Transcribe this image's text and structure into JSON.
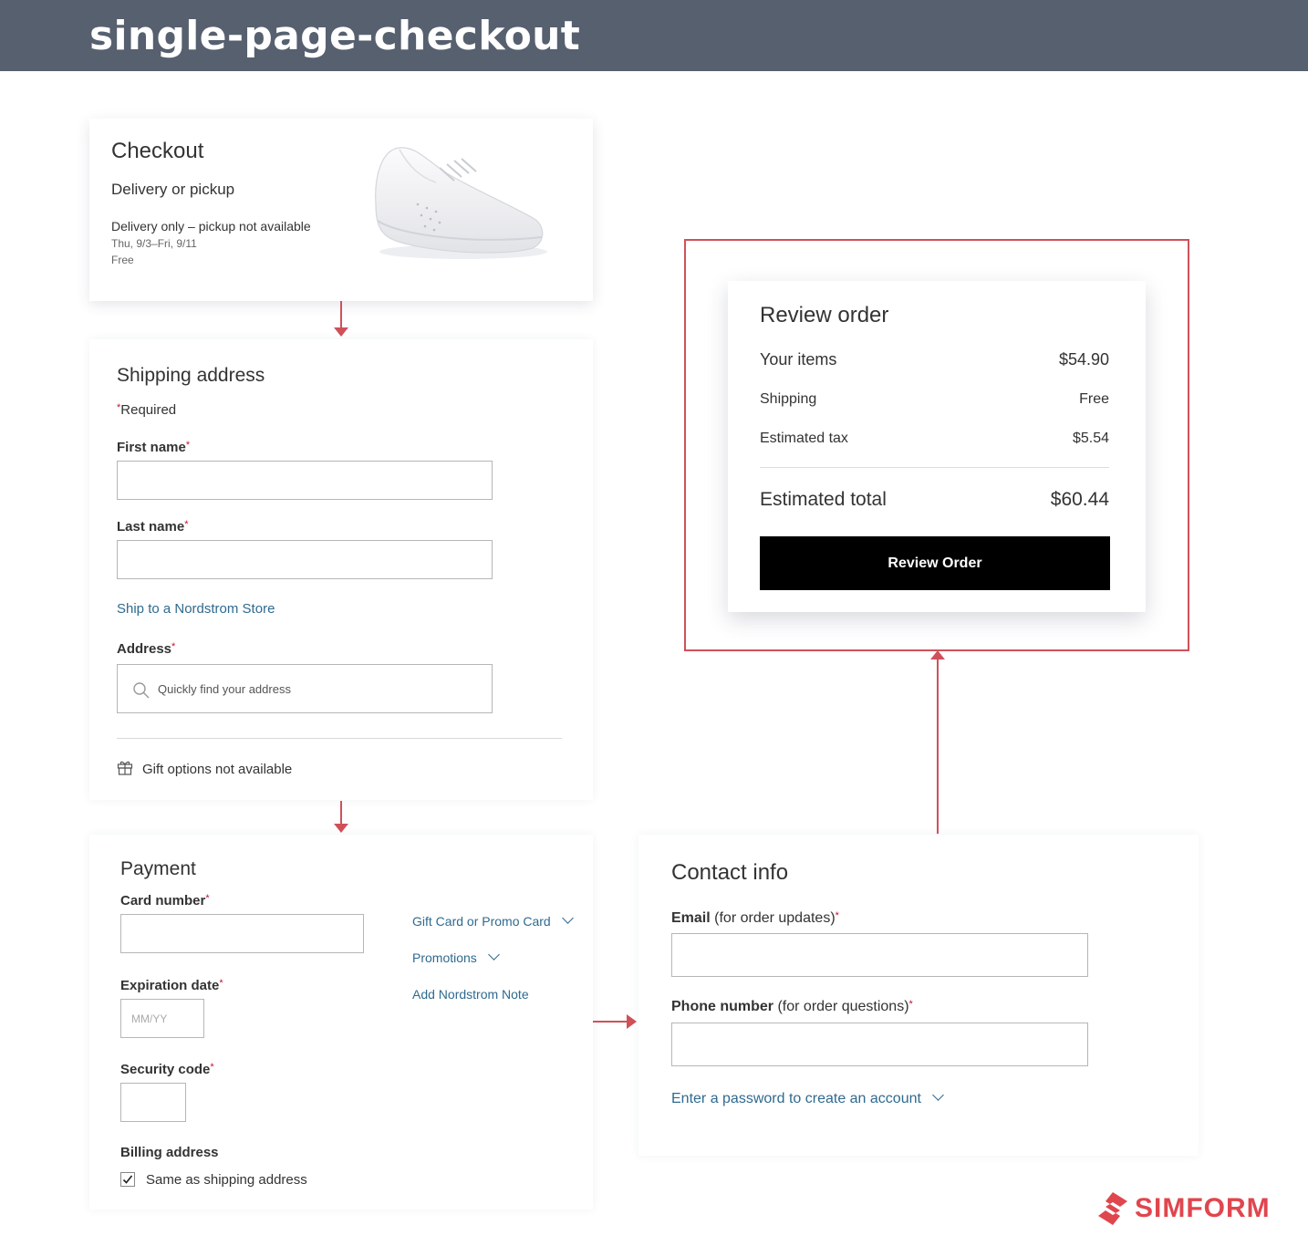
{
  "header": {
    "title": "single-page-checkout"
  },
  "checkout": {
    "title": "Checkout",
    "subtitle": "Delivery or pickup",
    "delivery_note": "Delivery only – pickup not available",
    "dates": "Thu, 9/3–Fri, 9/11",
    "cost": "Free"
  },
  "shipping": {
    "title": "Shipping address",
    "required_note": "Required",
    "first_name_label": "First name",
    "first_name_value": "",
    "last_name_label": "Last name",
    "last_name_value": "",
    "ship_to_store_link": "Ship to a Nordstrom Store",
    "address_label": "Address",
    "address_placeholder": "Quickly find your address",
    "gift_options": "Gift options not available"
  },
  "payment": {
    "title": "Payment",
    "card_number_label": "Card number",
    "card_number_value": "",
    "expiration_label": "Expiration date",
    "expiration_placeholder": "MM/YY",
    "security_label": "Security code",
    "security_value": "",
    "billing_label": "Billing address",
    "same_as_shipping": "Same as shipping address",
    "same_as_shipping_checked": true,
    "gift_card_link": "Gift Card or Promo Card",
    "promotions_link": "Promotions",
    "note_link": "Add Nordstrom Note"
  },
  "review": {
    "title": "Review order",
    "items_label": "Your items",
    "items_value": "$54.90",
    "shipping_label": "Shipping",
    "shipping_value": "Free",
    "tax_label": "Estimated tax",
    "tax_value": "$5.54",
    "total_label": "Estimated total",
    "total_value": "$60.44",
    "button_label": "Review Order"
  },
  "contact": {
    "title": "Contact info",
    "email_label": "Email",
    "email_hint": "(for order updates)",
    "email_value": "",
    "phone_label": "Phone number",
    "phone_hint": "(for order questions)",
    "phone_value": "",
    "create_account_link": "Enter a password to create an account"
  },
  "brand": {
    "name": "SIMFORM"
  },
  "colors": {
    "header_bg": "#56606f",
    "accent_red": "#d0505a",
    "link_blue": "#2f6a8f",
    "button_black": "#000000",
    "required_red": "#c8102e"
  }
}
